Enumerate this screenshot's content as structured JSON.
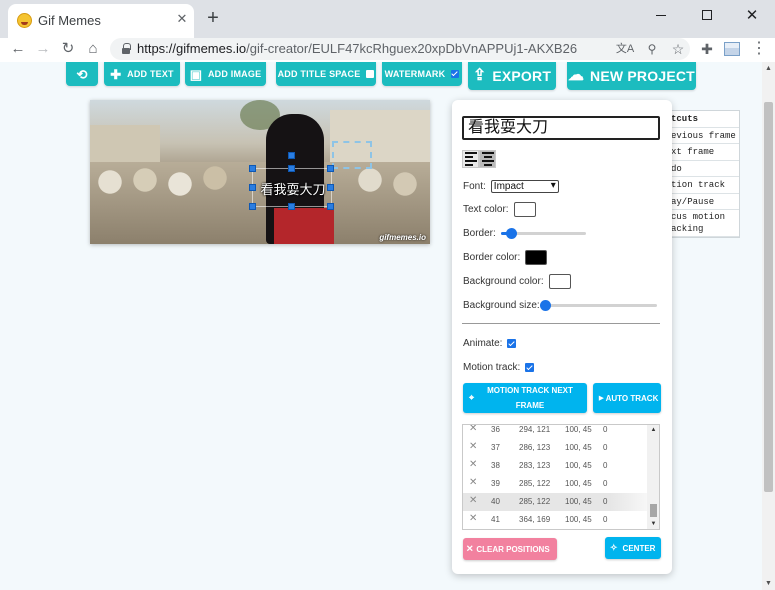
{
  "browser": {
    "tab_title": "Gif Memes",
    "tab_close": "✕",
    "new_tab": "+",
    "url_host": "https://gifmemes.io",
    "url_path": "/gif-creator/EULF47kcRhguex20xpDbVnAPPUj1-AKXB26",
    "icons": [
      "back-icon",
      "forward-icon",
      "reload-icon",
      "home-icon",
      "lock-icon",
      "translate-icon",
      "zoom-icon",
      "star-icon",
      "extensions-icon",
      "profile-icon",
      "menu-icon",
      "minimize-icon",
      "maximize-icon",
      "close-icon"
    ]
  },
  "toolbar": {
    "history_icon": "history-icon",
    "add_text": "ADD TEXT",
    "add_image": "ADD IMAGE",
    "add_title_space": "ADD TITLE SPACE",
    "watermark": "WATERMARK",
    "watermark_checked": true,
    "export": "EXPORT",
    "new_project": "NEW PROJECT",
    "accent_color": "#1cbcbf"
  },
  "canvas": {
    "overlay_text": "看我耍大刀",
    "watermark": "gifmemes.io"
  },
  "shortcuts": {
    "header": "tcuts",
    "rows": [
      "evious frame",
      "xt frame",
      "do",
      "tion track",
      "ay/Pause",
      "cus motion acking anchor"
    ]
  },
  "editor": {
    "text_value": "看我耍大刀",
    "align_left_icon": "align-left-icon",
    "align_center_icon": "align-center-icon",
    "font_label": "Font:",
    "font_value": "Impact",
    "text_color_label": "Text color:",
    "text_color": "#ffffff",
    "border_label": "Border:",
    "border_level": 0.12,
    "border_color_label": "Border color:",
    "border_color": "#000000",
    "bg_color_label": "Background color:",
    "bg_color": "#ffffff",
    "bg_size_label": "Background size:",
    "bg_size_level": 0.0,
    "animate_label": "Animate:",
    "animate_checked": true,
    "motion_track_label": "Motion track:",
    "motion_track_checked": true,
    "motion_next_btn": "MOTION TRACK NEXT FRAME",
    "auto_track_btn": "AUTO TRACK",
    "clear_btn": "CLEAR POSITIONS",
    "center_btn": "CENTER",
    "button_color": "#00b4ee",
    "clear_color": "#f2819f"
  },
  "positions": [
    {
      "frame": "36",
      "pos": "294, 121",
      "size": "100, 45",
      "z": "0"
    },
    {
      "frame": "37",
      "pos": "286, 123",
      "size": "100, 45",
      "z": "0"
    },
    {
      "frame": "38",
      "pos": "283, 123",
      "size": "100, 45",
      "z": "0"
    },
    {
      "frame": "39",
      "pos": "285, 122",
      "size": "100, 45",
      "z": "0"
    },
    {
      "frame": "40",
      "pos": "285, 122",
      "size": "100, 45",
      "z": "0",
      "selected": true
    },
    {
      "frame": "41",
      "pos": "364, 169",
      "size": "100, 45",
      "z": "0"
    }
  ]
}
